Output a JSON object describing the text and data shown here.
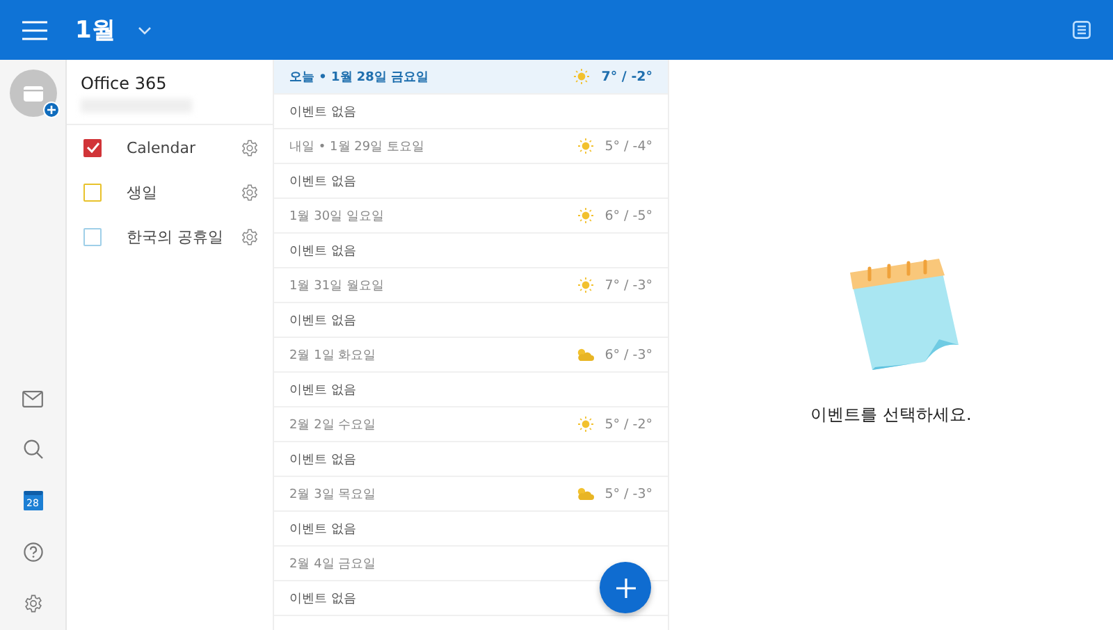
{
  "header": {
    "title": "1월"
  },
  "rail": [
    {
      "kind": "mail",
      "selected": false
    },
    {
      "kind": "search",
      "selected": false
    },
    {
      "kind": "calendar",
      "selected": true,
      "badge": "28"
    },
    {
      "kind": "help",
      "selected": false
    },
    {
      "kind": "settings",
      "selected": false
    }
  ],
  "account": {
    "name": "Office 365"
  },
  "calendars": [
    {
      "name": "Calendar",
      "checked": true,
      "color": "#d13438"
    },
    {
      "name": "생일",
      "checked": false,
      "color": "#e8c22c"
    },
    {
      "name": "한국의 공휴일",
      "checked": false,
      "color": "#9fcfe8"
    }
  ],
  "agenda": [
    {
      "date": "오늘 • 1월 28일 금요일",
      "today": true,
      "weather": {
        "kind": "sunny",
        "temp": "7° / -2°"
      },
      "events": "이벤트 없음"
    },
    {
      "date": "내일 • 1월 29일 토요일",
      "today": false,
      "weather": {
        "kind": "sunny",
        "temp": "5° / -4°"
      },
      "events": "이벤트 없음"
    },
    {
      "date": "1월 30일 일요일",
      "today": false,
      "weather": {
        "kind": "sunny",
        "temp": "6° / -5°"
      },
      "events": "이벤트 없음"
    },
    {
      "date": "1월 31일 월요일",
      "today": false,
      "weather": {
        "kind": "sunny",
        "temp": "7° / -3°"
      },
      "events": "이벤트 없음"
    },
    {
      "date": "2월 1일 화요일",
      "today": false,
      "weather": {
        "kind": "partly_cloudy",
        "temp": "6° / -3°"
      },
      "events": "이벤트 없음"
    },
    {
      "date": "2월 2일 수요일",
      "today": false,
      "weather": {
        "kind": "sunny",
        "temp": "5° / -2°"
      },
      "events": "이벤트 없음"
    },
    {
      "date": "2월 3일 목요일",
      "today": false,
      "weather": {
        "kind": "partly_cloudy",
        "temp": "5° / -3°"
      },
      "events": "이벤트 없음"
    },
    {
      "date": "2월 4일 금요일",
      "today": false,
      "events": "이벤트 없음"
    }
  ],
  "detail": {
    "message": "이벤트를 선택하세요."
  }
}
